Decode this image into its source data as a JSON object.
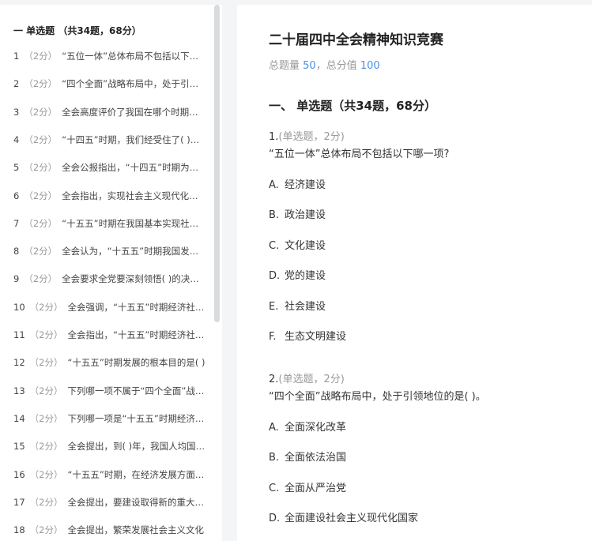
{
  "sidebar": {
    "header": "一 单选题 （共34题，68分）",
    "items": [
      {
        "num": "1",
        "pts": "（2分）",
        "text": "“五位一体”总体布局不包括以下哪一项?"
      },
      {
        "num": "2",
        "pts": "（2分）",
        "text": "“四个全面”战略布局中，处于引领地位的是"
      },
      {
        "num": "3",
        "pts": "（2分）",
        "text": "全会高度评价了我国在哪个时期取得的成就"
      },
      {
        "num": "4",
        "pts": "（2分）",
        "text": "“十四五”时期，我们经受住了( )的考验"
      },
      {
        "num": "5",
        "pts": "（2分）",
        "text": "全会公报指出，“十四五”时期为实现第二个"
      },
      {
        "num": "6",
        "pts": "（2分）",
        "text": "全会指出，实现社会主义现代化是一个阶段性"
      },
      {
        "num": "7",
        "pts": "（2分）",
        "text": "“十五五”时期在我国基本实现社会主义现代化"
      },
      {
        "num": "8",
        "pts": "（2分）",
        "text": "全会认为，“十五五”时期我国发展环境面临"
      },
      {
        "num": "9",
        "pts": "（2分）",
        "text": "全会要求全党要深刻领悟( )的决定性意义"
      },
      {
        "num": "10",
        "pts": "（2分）",
        "text": "全会强调，“十五五”时期经济社会发展"
      },
      {
        "num": "11",
        "pts": "（2分）",
        "text": "全会指出，“十五五”时期经济社会发展"
      },
      {
        "num": "12",
        "pts": "（2分）",
        "text": "“十五五”时期发展的根本目的是( )"
      },
      {
        "num": "13",
        "pts": "（2分）",
        "text": "下列哪一项不属于“四个全面”战略布局"
      },
      {
        "num": "14",
        "pts": "（2分）",
        "text": "下列哪一项是“十五五”时期经济社会发展"
      },
      {
        "num": "15",
        "pts": "（2分）",
        "text": "全会提出，到( )年，我国人均国内生产总值"
      },
      {
        "num": "16",
        "pts": "（2分）",
        "text": "“十五五”时期，在经济发展方面，全会"
      },
      {
        "num": "17",
        "pts": "（2分）",
        "text": "全会提出，要建设取得新的重大成就"
      },
      {
        "num": "18",
        "pts": "（2分）",
        "text": "全会提出，繁荣发展社会主义文化"
      }
    ]
  },
  "main": {
    "title": "二十届四中全会精神知识竞赛",
    "summary": {
      "label1": "总题量 ",
      "count": "50",
      "sep": "，总分值 ",
      "total": "100"
    },
    "section": "一、 单选题（共34题，68分）",
    "questions": [
      {
        "num": "1.",
        "meta": "(单选题，2分)",
        "text": "“五位一体”总体布局不包括以下哪一项?",
        "options": [
          {
            "letter": "A.",
            "text": "经济建设"
          },
          {
            "letter": "B.",
            "text": "政治建设"
          },
          {
            "letter": "C.",
            "text": "文化建设"
          },
          {
            "letter": "D.",
            "text": "党的建设"
          },
          {
            "letter": "E.",
            "text": "社会建设"
          },
          {
            "letter": "F.",
            "text": "生态文明建设"
          }
        ]
      },
      {
        "num": "2.",
        "meta": "(单选题，2分)",
        "text": "“四个全面”战略布局中，处于引领地位的是(    )。",
        "options": [
          {
            "letter": "A.",
            "text": "全面深化改革"
          },
          {
            "letter": "B.",
            "text": "全面依法治国"
          },
          {
            "letter": "C.",
            "text": "全面从严治党"
          },
          {
            "letter": "D.",
            "text": "全面建设社会主义现代化国家"
          }
        ]
      }
    ]
  },
  "colors": {
    "accent": "#4a90e2",
    "muted": "#999999",
    "panel": "#ffffff",
    "background": "#f4f5f7"
  }
}
